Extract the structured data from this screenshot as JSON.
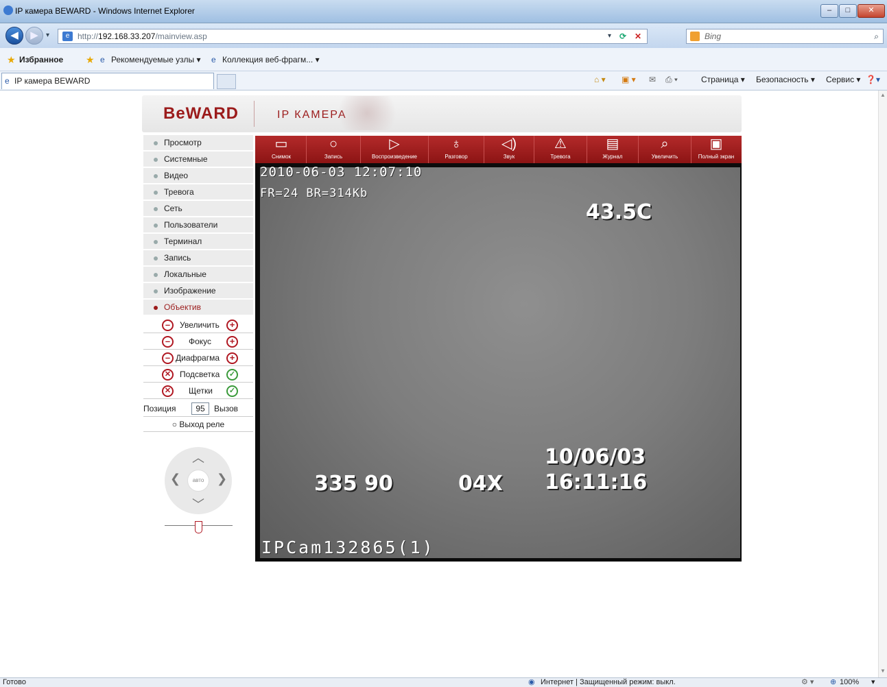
{
  "window": {
    "title": "IP камера BEWARD - Windows Internet Explorer",
    "min": "–",
    "max": "□",
    "close": "✕"
  },
  "nav": {
    "url_prefix": "http://",
    "url_host": "192.168.33.207",
    "url_path": "/mainview.asp",
    "search_placeholder": "Bing"
  },
  "favorites": {
    "label": "Избранное",
    "recommended": "Рекомендуемые узлы ▾",
    "gallery": "Коллекция веб-фрагм... ▾"
  },
  "tabs": {
    "active": "IP камера BEWARD"
  },
  "toolbar_ie": {
    "page": "Страница ▾",
    "security": "Безопасность ▾",
    "service": "Сервис ▾"
  },
  "page": {
    "logo": "BeWARD",
    "header": "IP КАМЕРА"
  },
  "menu": [
    {
      "label": "Просмотр"
    },
    {
      "label": "Системные"
    },
    {
      "label": "Видео"
    },
    {
      "label": "Тревога"
    },
    {
      "label": "Сеть"
    },
    {
      "label": "Пользователи"
    },
    {
      "label": "Терминал"
    },
    {
      "label": "Запись"
    },
    {
      "label": "Локальные"
    },
    {
      "label": "Изображение"
    },
    {
      "label": "Объектив"
    }
  ],
  "lens": {
    "zoom": "Увеличить",
    "focus": "Фокус",
    "iris": "Диафрагма",
    "backlight": "Подсветка",
    "wiper": "Щетки",
    "position_label": "Позиция",
    "position_value": "95",
    "call": "Вызов",
    "relay": "Выход реле",
    "auto": "авто"
  },
  "cam_toolbar": [
    {
      "label": "Снимок",
      "icon": "snapshot-icon"
    },
    {
      "label": "Запись",
      "icon": "record-icon"
    },
    {
      "label": "Воспроизведение",
      "icon": "play-icon"
    },
    {
      "label": "Разговор",
      "icon": "microphone-icon"
    },
    {
      "label": "Звук",
      "icon": "speaker-icon"
    },
    {
      "label": "Тревога",
      "icon": "alarm-icon"
    },
    {
      "label": "Журнал",
      "icon": "log-icon"
    },
    {
      "label": "Увеличить",
      "icon": "zoom-icon"
    },
    {
      "label": "Полный экран",
      "icon": "fullscreen-icon"
    }
  ],
  "osd": {
    "timestamp": "2010-06-03 12:07:10",
    "stats": "FR=24 BR=314Kb",
    "temp": "43.5C",
    "date": "10/06/03",
    "time": "16:11:16",
    "pan_tilt": "335 90",
    "zoom": "04X",
    "camera_name": "IPCam132865(1)"
  },
  "status": {
    "left": "Готово",
    "zone": "Интернет | Защищенный режим: выкл.",
    "zoom": "100%"
  },
  "colors": {
    "brand": "#9b1b1b",
    "toolbar": "#a01f1f"
  }
}
